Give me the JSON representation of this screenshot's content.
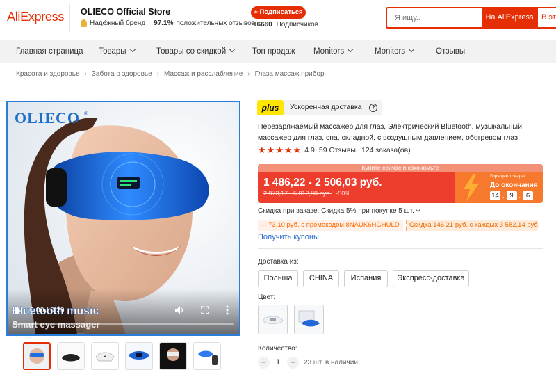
{
  "header": {
    "logo": "AliExpress",
    "store_name": "OLIECO Official Store",
    "store_caret": "▾",
    "brand_badge": "Надёжный бренд",
    "positive_reviews_pct": "97.1%",
    "positive_reviews_label": "положительных отзывов",
    "subscribe_label": "+ Подписаться",
    "subscribers_count": "16660",
    "subscribers_label": "Подписчиков",
    "search_placeholder": "Я ищу..",
    "search_button": "На AliExpress",
    "search_button2": "В это"
  },
  "nav": {
    "items": [
      {
        "label": "Главная страница"
      },
      {
        "label": "Товары"
      },
      {
        "label": "Товары со скидкой"
      },
      {
        "label": "Топ продаж"
      },
      {
        "label": "Monitors"
      },
      {
        "label": "Monitors"
      },
      {
        "label": "Отзывы"
      }
    ]
  },
  "breadcrumb": [
    "Красота и здоровье",
    "Забота о здоровье",
    "Массаж и расслабление",
    "Глаза массаж прибор"
  ],
  "media": {
    "brand_watermark": "OLIECO",
    "brand_r": "®",
    "video_time": "0:00 / 0:29",
    "overlay_text_1": "Bluetooth music",
    "overlay_text_2": "Smart eye massager"
  },
  "product": {
    "delivery_badge": "plus",
    "delivery_label": "Ускоренная доставка",
    "title": "Перезаряжаемый массажер для глаз, Электрический Bluetooth, музыкальный массажер для глаз, спа, складной, с воздушным давлением, обогревом глаз",
    "rating": "4.9",
    "reviews": "59 Отзывы",
    "orders": "124 заказа(ов)",
    "stars": 5,
    "price_banner": "Купите сейчас и сэкономьте",
    "price_range": "1 486,22 - 2 506,03 руб.",
    "old_price": "2 973,17 - 5 012,80 руб.",
    "discount_pct": "-50%",
    "deal_label": "Горящие товары",
    "deal_until": "До окончания",
    "timer": [
      "14",
      "9",
      "6"
    ],
    "order_discount": "Скидка при заказе: Скидка 5% при покупке 5 шт.",
    "promo_code": "— 73,10 руб. с промокодом 8NAUK6HGHULD",
    "promo_discount": "Скидка 146,21 руб. с каждых 3 582,14 руб.",
    "coupons_link": "Получить купоны",
    "ship_from_label": "Доставка из:",
    "ship_from": [
      "Польша",
      "CHINA",
      "Испания",
      "Экспресс-доставка"
    ],
    "color_label": "Цвет:",
    "quantity_label": "Количество:",
    "quantity": "1",
    "minus": "−",
    "plus": "+",
    "stock": "23 шт. в наличии"
  },
  "colors": {
    "accent": "#e62e04",
    "link": "#2a6cc8",
    "plus_badge": "#ffe600",
    "promo_orange": "#ff6a00"
  }
}
